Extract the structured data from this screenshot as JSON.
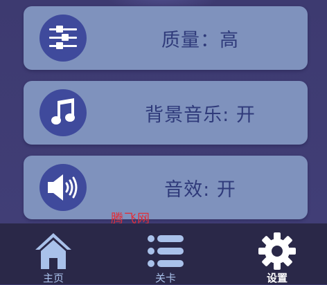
{
  "settings": [
    {
      "label": "质量：高",
      "icon": "equalizer-icon"
    },
    {
      "label": "背景音乐: 开",
      "icon": "music-note-icon"
    },
    {
      "label": "音效: 开",
      "icon": "speaker-icon"
    }
  ],
  "watermark": "腾飞网",
  "nav": {
    "home_label": "主页",
    "levels_label": "关卡",
    "settings_label": "设置",
    "active": "设置"
  },
  "colors": {
    "background": "#3d3a70",
    "card": "#7f92bd",
    "icon_circle": "#3f4a9c",
    "text": "#2f3a7a",
    "nav_bar": "#2a2848",
    "nav_icon": "#a9c1ea",
    "nav_active": "#ffffff",
    "watermark": "#e0303a"
  }
}
